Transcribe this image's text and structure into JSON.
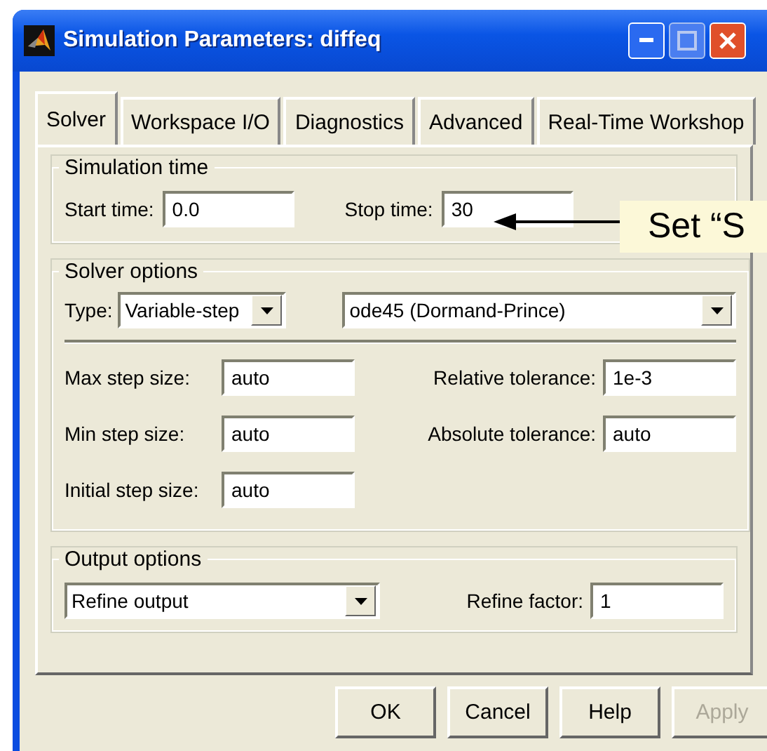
{
  "window": {
    "title": "Simulation Parameters: diffeq"
  },
  "tabs": [
    {
      "label": "Solver",
      "selected": true
    },
    {
      "label": "Workspace I/O",
      "selected": false
    },
    {
      "label": "Diagnostics",
      "selected": false
    },
    {
      "label": "Advanced",
      "selected": false
    },
    {
      "label": "Real-Time Workshop",
      "selected": false
    }
  ],
  "simulation_time": {
    "title": "Simulation time",
    "fields": [
      {
        "label": "Start time:",
        "value": "0.0"
      },
      {
        "label": "Stop time:",
        "value": "30"
      }
    ]
  },
  "solver_options": {
    "title": "Solver options",
    "type_label": "Type:",
    "type_value": "Variable-step",
    "solver_value": "ode45 (Dormand-Prince)",
    "rows": [
      [
        {
          "label": "Max step size:",
          "value": "auto"
        },
        {
          "label": "Relative tolerance:",
          "value": "1e-3"
        }
      ],
      [
        {
          "label": "Min step size:",
          "value": "auto"
        },
        {
          "label": "Absolute tolerance:",
          "value": "auto"
        }
      ],
      [
        {
          "label": "Initial step size:",
          "value": "auto"
        }
      ]
    ]
  },
  "output_options": {
    "title": "Output options",
    "mode": "Refine output",
    "factor_label": "Refine factor:",
    "factor_value": "1"
  },
  "buttons": [
    {
      "label": "OK",
      "disabled": false
    },
    {
      "label": "Cancel",
      "disabled": false
    },
    {
      "label": "Help",
      "disabled": false
    },
    {
      "label": "Apply",
      "disabled": true
    }
  ],
  "callout": {
    "text": "Set “S"
  }
}
